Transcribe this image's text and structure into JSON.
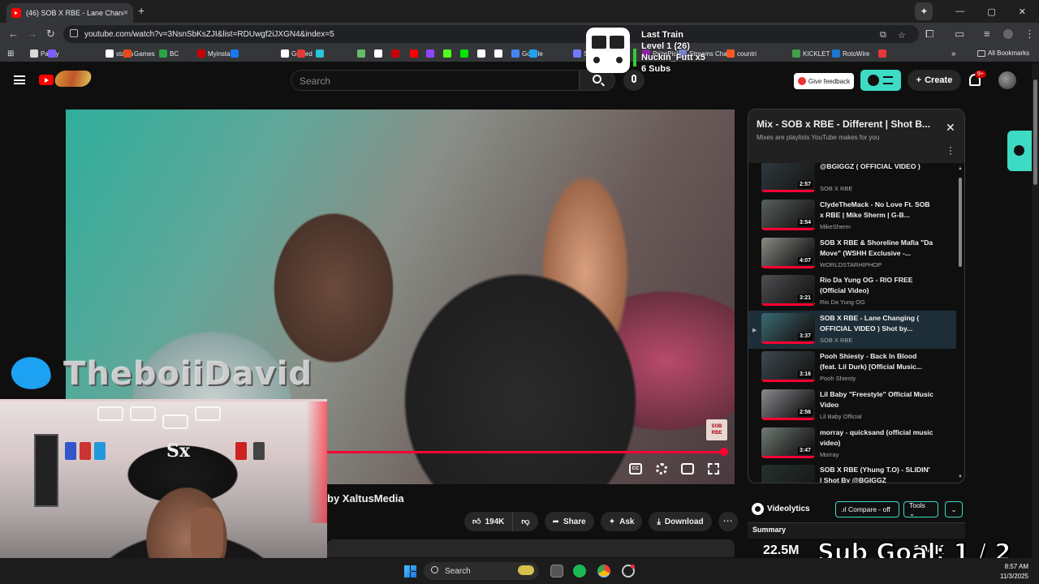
{
  "browser": {
    "tab_title": "(46) SOB X RBE - Lane Chang",
    "tab_close": "×",
    "new_tab": "+",
    "url": "youtube.com/watch?v=3NsnSbKsZJI&list=RDUwgf2iJXGN4&index=5",
    "window_controls": [
      "—",
      "▢",
      "✕"
    ]
  },
  "bookmarks": [
    {
      "label": "Parlay",
      "color": "#d9d9d9"
    },
    {
      "label": "",
      "color": "#7a5cff"
    },
    {
      "label": "status",
      "color": "#ffffff"
    },
    {
      "label": "Games",
      "color": "#e64a19"
    },
    {
      "label": "BC",
      "color": "#28a745"
    },
    {
      "label": "Myinstants",
      "color": "#cc0000"
    },
    {
      "label": "",
      "color": "#1877f2"
    },
    {
      "label": "Grailed",
      "color": "#ffffff"
    },
    {
      "label": "",
      "color": "#e53935"
    },
    {
      "label": "",
      "color": "#26c6da"
    },
    {
      "label": "",
      "color": "#66bb6a"
    },
    {
      "label": "",
      "color": "#ffffff"
    },
    {
      "label": "",
      "color": "#cc0000"
    },
    {
      "label": "",
      "color": "#ff0000"
    },
    {
      "label": "",
      "color": "#9146ff"
    },
    {
      "label": "",
      "color": "#53fc18"
    },
    {
      "label": "",
      "color": "#00e701"
    },
    {
      "label": "",
      "color": "#ffffff"
    },
    {
      "label": "",
      "color": "#ffffff"
    },
    {
      "label": "Google",
      "color": "#4285f4"
    },
    {
      "label": "",
      "color": "#1da1f2"
    },
    {
      "label": "Stake",
      "color": "#6f7bff"
    },
    {
      "label": "PrizePicks",
      "color": "#8e24aa"
    },
    {
      "label": "Streams Charts",
      "color": "#7986cb"
    },
    {
      "label": "countri",
      "color": "#ff5722"
    },
    {
      "label": "KICKLET",
      "color": "#43a047"
    },
    {
      "label": "RotoWire",
      "color": "#1976d2"
    },
    {
      "label": "",
      "color": "#e53935"
    }
  ],
  "bookmarks_overflow": "»",
  "all_bookmarks": "All Bookmarks",
  "stream_overlay": {
    "line1": "Last Train",
    "line2": "Level 1  (26)",
    "line3": "Nuckin_Futt x5",
    "line4": "6 Subs"
  },
  "youtube": {
    "search_placeholder": "Search",
    "feedback_label": "Give feedback",
    "create_label": "Create",
    "notification_badge": "9+"
  },
  "player": {
    "watermark": "SOB RBE",
    "progress_fraction": 0.99,
    "cc_label": "CC",
    "miniplayer_label": ""
  },
  "overlay": {
    "twitter_handle": "TheboiiDavid",
    "sub_goal": "Sub Goal:  1 / 2"
  },
  "video_info": {
    "byline": "by XaltusMedia",
    "actions": {
      "like_count": "194K",
      "share": "Share",
      "ask": "Ask",
      "download": "Download",
      "more": "⋯"
    }
  },
  "playlist": {
    "title": "Mix - SOB x RBE - Different | Shot B...",
    "subtitle": "Mixes are playlists YouTube makes for you",
    "items": [
      {
        "title": "@BGIGGZ ( OFFICIAL VIDEO )",
        "channel": "SOB X RBE",
        "duration": "2:57",
        "active": false,
        "thumb": "#2f3a3f"
      },
      {
        "title": "ClydeTheMack - No Love Ft. SOB x RBE | Mike Sherm | G-B...",
        "channel": "MikeSherm",
        "duration": "3:54",
        "active": false,
        "thumb": "#59605e"
      },
      {
        "title": "SOB X RBE & Shoreline Mafia \"Da Move\" (WSHH Exclusive -...",
        "channel": "WORLDSTARHIPHOP",
        "duration": "4:07",
        "active": false,
        "thumb": "#8c8a84"
      },
      {
        "title": "Rio Da Yung OG - RIO FREE (Official Video)",
        "channel": "Rio Da Yung OG",
        "duration": "3:21",
        "active": false,
        "thumb": "#4d4f52"
      },
      {
        "title": "SOB X RBE - Lane Changing ( OFFICIAL VIDEO ) Shot by...",
        "channel": "SOB X RBE",
        "duration": "3:37",
        "active": true,
        "thumb": "#3a6b74"
      },
      {
        "title": "Pooh Shiesty - Back In Blood (feat. Lil Durk) [Official Music...",
        "channel": "Pooh Shiesty",
        "duration": "3:16",
        "active": false,
        "thumb": "#3d4a52"
      },
      {
        "title": "Lil Baby \"Freestyle\" Official Music Video",
        "channel": "Lil Baby Official",
        "duration": "2:56",
        "active": false,
        "thumb": "#8a8b90"
      },
      {
        "title": "morray - quicksand (official music video)",
        "channel": "Morray",
        "duration": "3:47",
        "active": false,
        "thumb": "#6f7a72"
      },
      {
        "title": "SOB X RBE (Yhung T.O) - SLIDIN' | Shot By @BGIGGZ",
        "channel": "",
        "duration": "2:57",
        "active": false,
        "thumb": "#233230"
      }
    ]
  },
  "videolytics": {
    "name": "Videolytics",
    "compare_label": ".ıl Compare - off",
    "tools_label": "Tools ⌄",
    "dropdown": "⌄",
    "summary_label": "Summary",
    "views": "22.5M",
    "likes": "194K"
  },
  "taskbar": {
    "search_label": "Search",
    "time": "8:57 AM",
    "date": "11/3/2025"
  }
}
